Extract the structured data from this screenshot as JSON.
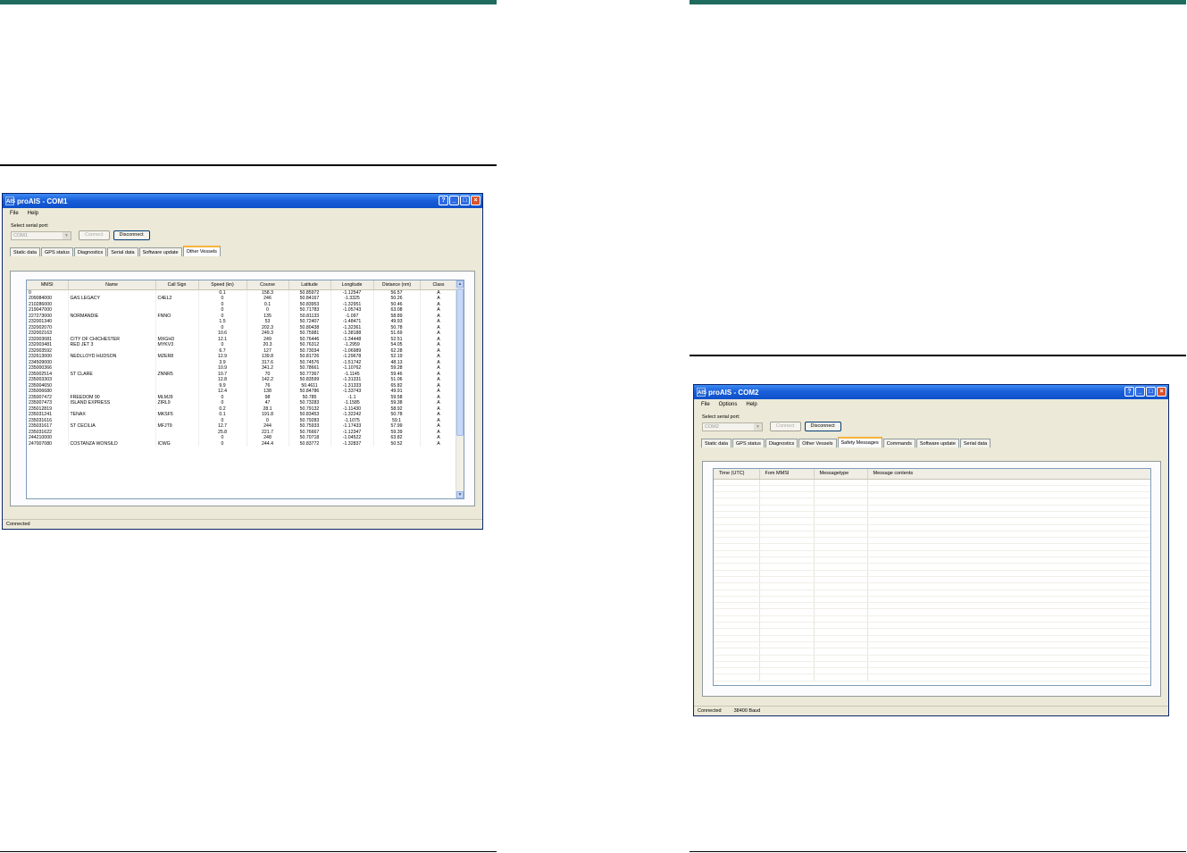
{
  "left_window": {
    "title": "proAIS - COM1",
    "menu": [
      "File",
      "Help"
    ],
    "port_label": "Select serial port:",
    "port_value": "COM1",
    "connect_label": "Connect",
    "disconnect_label": "Disconnect",
    "tabs": [
      "Static data",
      "GPS status",
      "Diagnostics",
      "Serial data",
      "Software update",
      "Other Vessels"
    ],
    "selected_tab": "Other Vessels",
    "columns": [
      "MMSI",
      "Name",
      "Call Sign",
      "Speed (kn)",
      "Course",
      "Latitude",
      "Longitude",
      "Distance (nm)",
      "Class"
    ],
    "rows": [
      [
        "0",
        "",
        "",
        "0.1",
        "158.3",
        "50.85972",
        "-1.12547",
        "56.57",
        "A"
      ],
      [
        "209084000",
        "GAS LEGACY",
        "C4EL2",
        "0",
        "246",
        "50.84167",
        "-1.3325",
        "50.26",
        "A"
      ],
      [
        "210286000",
        "",
        "",
        "0",
        "0.1",
        "50.83953",
        "-1.32951",
        "50.46",
        "A"
      ],
      [
        "219047000",
        "",
        "",
        "0",
        "0",
        "50.71783",
        "-1.05743",
        "63.08",
        "A"
      ],
      [
        "227273000",
        "NORMANDIE",
        "FNNO",
        "0",
        "135",
        "50.81133",
        "-1.097",
        "58.89",
        "A"
      ],
      [
        "232001340",
        "",
        "",
        "1.5",
        "53",
        "50.72407",
        "-1.48471",
        "49.93",
        "A"
      ],
      [
        "232002070",
        "",
        "",
        "0",
        "202.3",
        "50.80438",
        "-1.32361",
        "50.78",
        "A"
      ],
      [
        "232002163",
        "",
        "",
        "10.6",
        "249.3",
        "50.75981",
        "-1.38188",
        "51.69",
        "A"
      ],
      [
        "232003081",
        "CITY OF CHICHESTER",
        "MXGH3",
        "12.1",
        "249",
        "50.76446",
        "-1.34448",
        "52.51",
        "A"
      ],
      [
        "232003481",
        "RED JET 3",
        "MYKV3",
        "0",
        "20.3",
        "50.76312",
        "-1.2959",
        "54.05",
        "A"
      ],
      [
        "232003592",
        "",
        "",
        "6.7",
        "127",
        "50.73034",
        "-1.06989",
        "62.28",
        "A"
      ],
      [
        "232613000",
        "NEDLLOYD HUDSON",
        "MZER8",
        "12.9",
        "139.8",
        "50.81726",
        "-1.29678",
        "52.19",
        "A"
      ],
      [
        "234509000",
        "",
        "",
        "3.9",
        "317.6",
        "50.74576",
        "-1.51742",
        "48.13",
        "A"
      ],
      [
        "235000366",
        "",
        "",
        "10.9",
        "341.2",
        "50.78661",
        "-1.10762",
        "59.28",
        "A"
      ],
      [
        "235002514",
        "ST CLARE",
        "ZNNR5",
        "10.7",
        "70",
        "50.77367",
        "-1.1145",
        "59.46",
        "A"
      ],
      [
        "235003303",
        "",
        "",
        "12.8",
        "142.2",
        "50.83599",
        "-1.31331",
        "51.06",
        "A"
      ],
      [
        "235004650",
        "",
        "",
        "9.9",
        "76",
        "50.4611",
        "-1.31333",
        "65.82",
        "A"
      ],
      [
        "235006680",
        "",
        "",
        "12.4",
        "138",
        "50.84786",
        "-1.33743",
        "49.91",
        "A"
      ],
      [
        "235007472",
        "FREEDOM 90",
        "MLMJ9",
        "0",
        "98",
        "50.785",
        "-1.1",
        "59.58",
        "A"
      ],
      [
        "235007473",
        "ISLAND EXPRESS",
        "ZIRL9",
        "0",
        "47",
        "50.73283",
        "-1.1585",
        "59.38",
        "A"
      ],
      [
        "235012819",
        "",
        "",
        "0.2",
        "28.1",
        "50.79132",
        "-1.11430",
        "58.92",
        "A"
      ],
      [
        "235031241",
        "TENAX",
        "MKSF5",
        "0.1",
        "191.8",
        "50.83453",
        "-1.32242",
        "50.78",
        "A"
      ],
      [
        "235031616",
        "",
        "",
        "0",
        "0",
        "50.79283",
        "-1.1075",
        "59.1",
        "A"
      ],
      [
        "235031617",
        "ST CECILIA",
        "MFJT9",
        "12.7",
        "244",
        "50.75933",
        "-1.17433",
        "57.99",
        "A"
      ],
      [
        "235031622",
        "",
        "",
        "25.8",
        "221.7",
        "50.76667",
        "-1.12347",
        "59.39",
        "A"
      ],
      [
        "244210000",
        "",
        "",
        "0",
        "248",
        "50.70718",
        "-1.04522",
        "63.82",
        "A"
      ],
      [
        "247007080",
        "COSTANZA WONSILD",
        "ICWG",
        "0",
        "244.4",
        "50.83772",
        "-1.32837",
        "50.52",
        "A"
      ]
    ],
    "status": "Connected"
  },
  "right_window": {
    "title": "proAIS - COM2",
    "menu": [
      "File",
      "Options",
      "Help"
    ],
    "port_label": "Select serial port:",
    "port_value": "COM2",
    "connect_label": "Connect",
    "disconnect_label": "Disconnect",
    "tabs": [
      "Static data",
      "GPS status",
      "Diagnostics",
      "Other Vessels",
      "Safety Messages",
      "Commands",
      "Software update",
      "Serial data"
    ],
    "selected_tab": "Safety Messages",
    "columns": [
      "Time (UTC)",
      "Fom MMSI",
      "Messagetype",
      "Message contents"
    ],
    "status": "Connected",
    "baud": "38400 Baud"
  }
}
